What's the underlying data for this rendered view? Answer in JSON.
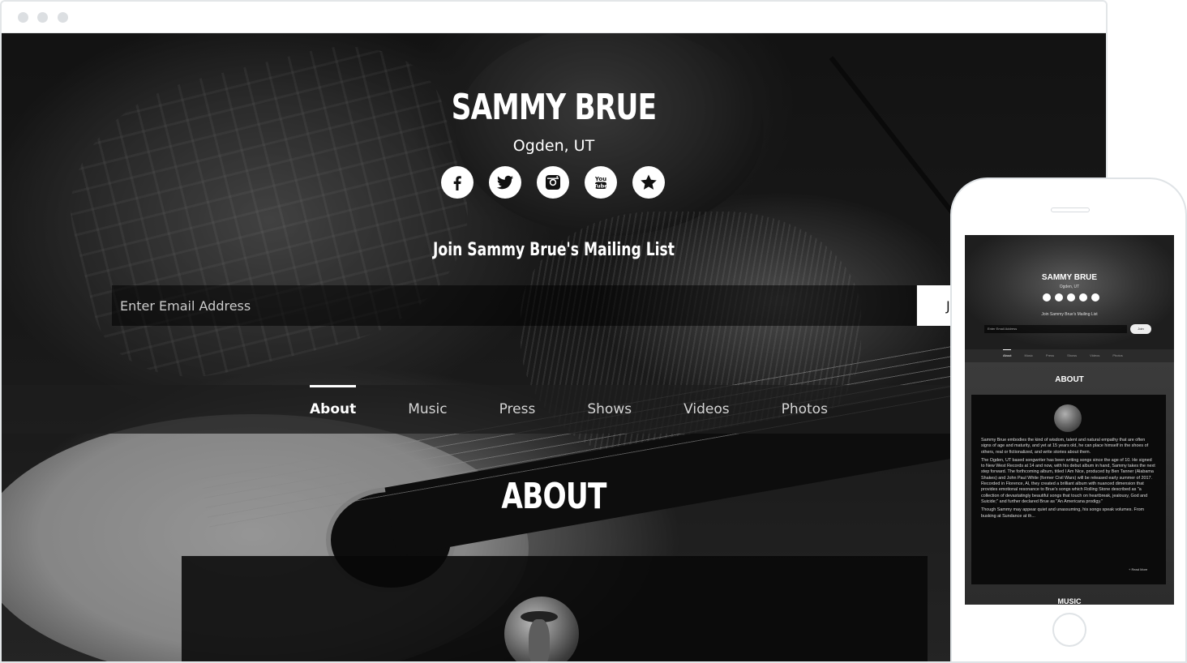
{
  "artist": {
    "name": "SAMMY BRUE",
    "location": "Ogden, UT"
  },
  "social": [
    {
      "icon": "facebook-icon"
    },
    {
      "icon": "twitter-icon"
    },
    {
      "icon": "instagram-icon"
    },
    {
      "icon": "youtube-icon"
    },
    {
      "icon": "star-icon"
    }
  ],
  "mailing": {
    "heading": "Join Sammy Brue's Mailing List",
    "placeholder": "Enter Email Address",
    "join_label": "J"
  },
  "nav": {
    "items": [
      "About",
      "Music",
      "Press",
      "Shows",
      "Videos",
      "Photos"
    ],
    "active": "About"
  },
  "section": {
    "title": "ABOUT"
  },
  "mobile": {
    "title": "SAMMY BRUE",
    "location": "Ogden, UT",
    "mailing": "Join Sammy Brue's Mailing List",
    "placeholder": "Enter Email Address",
    "join": "Join",
    "nav": [
      "About",
      "Music",
      "Press",
      "Shows",
      "Videos",
      "Photos"
    ],
    "section_title": "ABOUT",
    "about_paragraphs": [
      "Sammy Brue embodies the kind of wisdom, talent and natural empathy that are often signs of age and maturity, and yet at 15 years old, he can place himself in the shoes of others, real or fictionalized, and write stories about them.",
      "The Ogden, UT based songwriter has been writing songs since the age of 10. He signed to New West Records at 14 and now, with his debut album in hand, Sammy takes the next step forward. The forthcoming album, titled I Am Nice, produced by Ben Tanner (Alabama Shakes) and John Paul White (former Civil Wars) will be released early summer of 2017. Recorded in Florence, Al, they created a brilliant album with nuanced dimension that provides emotional resonance to Brue's songs which Rolling Stone described as \"a collection of devastatingly beautiful songs that touch on heartbreak, jealousy, God and Suicide;\" and further declared Brue as \"An Americana prodigy.\"",
      "Though Sammy may appear quiet and unassuming, his songs speak volumes. From busking at Sundance at th..."
    ],
    "read_more": "+ Read More",
    "next_section": "MUSIC"
  },
  "colors": {
    "overlay": "#000000",
    "text": "#ffffff",
    "navbar": "#1e1e1e",
    "frame": "#e3e6e8"
  }
}
